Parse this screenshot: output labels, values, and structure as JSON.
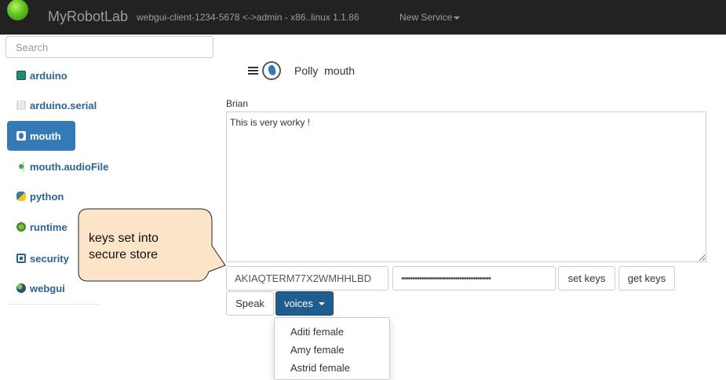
{
  "navbar": {
    "brand": "MyRobotLab",
    "info": "webgui-client-1234-5678 <->admin - x86..linux 1.1.86",
    "new_service": "New Service"
  },
  "sidebar": {
    "search_placeholder": "Search",
    "items": [
      {
        "label": "arduino",
        "icon": "arduino-icon"
      },
      {
        "label": "arduino.serial",
        "icon": "serial-icon"
      },
      {
        "label": "mouth",
        "icon": "polly-icon",
        "active": true
      },
      {
        "label": "mouth.audioFile",
        "icon": "audio-icon"
      },
      {
        "label": "python",
        "icon": "python-icon"
      },
      {
        "label": "runtime",
        "icon": "runtime-icon"
      },
      {
        "label": "security",
        "icon": "security-icon"
      },
      {
        "label": "webgui",
        "icon": "webgui-icon"
      }
    ]
  },
  "main": {
    "title": "Polly  mouth",
    "voice_name": "Brian",
    "speech_text": "This is very worky !",
    "access_key": "AKIAQTERM77X2WMHHLBD",
    "secret_key_masked": "••••••••••••••••••••••••••••••••••••••••",
    "set_keys": "set keys",
    "get_keys": "get keys",
    "speak": "Speak",
    "voices": "voices",
    "voice_options": [
      "Aditi female",
      "Amy female",
      "Astrid female"
    ]
  },
  "callout": {
    "line1": "keys set into",
    "line2": "secure store"
  },
  "colors": {
    "navbar": "#222222",
    "accent": "#337ab7",
    "primary_button": "#1f5d8f",
    "callout_fill": "#fce4c8"
  }
}
